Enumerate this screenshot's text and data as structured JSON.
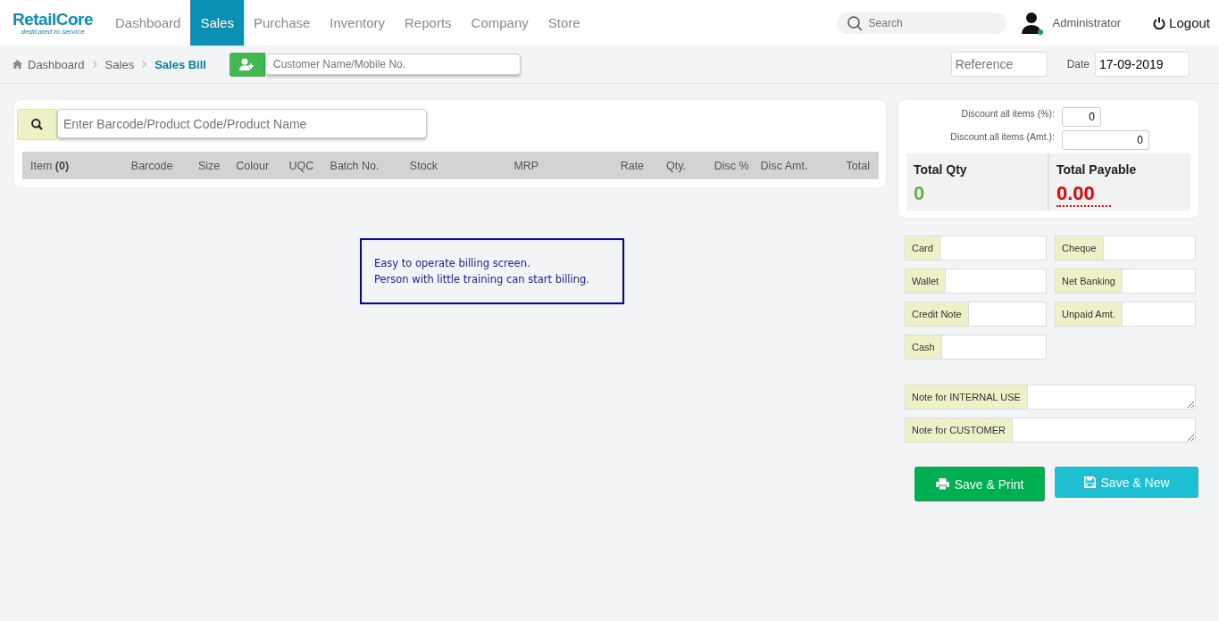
{
  "brand": {
    "name": "RetailCore",
    "tagline": "dedicated to service"
  },
  "nav": [
    {
      "label": "Dashboard",
      "selected": false
    },
    {
      "label": "Sales",
      "selected": true
    },
    {
      "label": "Purchase",
      "selected": false
    },
    {
      "label": "Inventory",
      "selected": false
    },
    {
      "label": "Reports",
      "selected": false
    },
    {
      "label": "Company",
      "selected": false
    },
    {
      "label": "Store",
      "selected": false
    }
  ],
  "search": {
    "placeholder": "Search"
  },
  "user": {
    "name": "Administrator",
    "online": true
  },
  "logout": "Logout",
  "breadcrumb": [
    "Dashboard",
    "Sales",
    "Sales Bill"
  ],
  "customer": {
    "placeholder": "Customer Name/Mobile No."
  },
  "reference": {
    "placeholder": "Reference"
  },
  "date": {
    "label": "Date",
    "value": "17-09-2019"
  },
  "product_search": {
    "placeholder": "Enter Barcode/Product Code/Product Name"
  },
  "table": {
    "columns": [
      {
        "label": "Item **(0)**"
      },
      {
        "label": "Barcode"
      },
      {
        "label": "Size"
      },
      {
        "label": "Colour"
      },
      {
        "label": "UQC"
      },
      {
        "label": "Batch No."
      },
      {
        "label": "Stock"
      },
      {
        "label": "MRP"
      },
      {
        "label": "Rate"
      },
      {
        "label": "Qty."
      },
      {
        "label": "Disc %"
      },
      {
        "label": "Disc Amt."
      },
      {
        "label": "Total"
      }
    ]
  },
  "note": [
    "Easy to operate billing screen.",
    "Person with little training can start billing."
  ],
  "discounts": [
    {
      "label": "Discount all items (%):",
      "value": "0",
      "kind": "small"
    },
    {
      "label": "Discount all items (Amt.):",
      "value": "0",
      "kind": "wide"
    }
  ],
  "totals": [
    {
      "label": "Total Qty",
      "value": "0",
      "kind": "qty"
    },
    {
      "label": "Total Payable",
      "value": "0.00",
      "kind": "payable"
    }
  ],
  "payments": [
    {
      "label": "Card"
    },
    {
      "label": "Cheque"
    },
    {
      "label": "Wallet"
    },
    {
      "label": "Net Banking"
    },
    {
      "label": "Credit Note"
    },
    {
      "label": "Unpaid Amt."
    },
    {
      "label": "Cash"
    }
  ],
  "notes": [
    {
      "label": "Note for INTERNAL USE"
    },
    {
      "label": "Note for CUSTOMER"
    }
  ],
  "buttons": [
    {
      "label": "Save & Print",
      "kind": "print"
    },
    {
      "label": "Save & New",
      "kind": "new"
    }
  ]
}
